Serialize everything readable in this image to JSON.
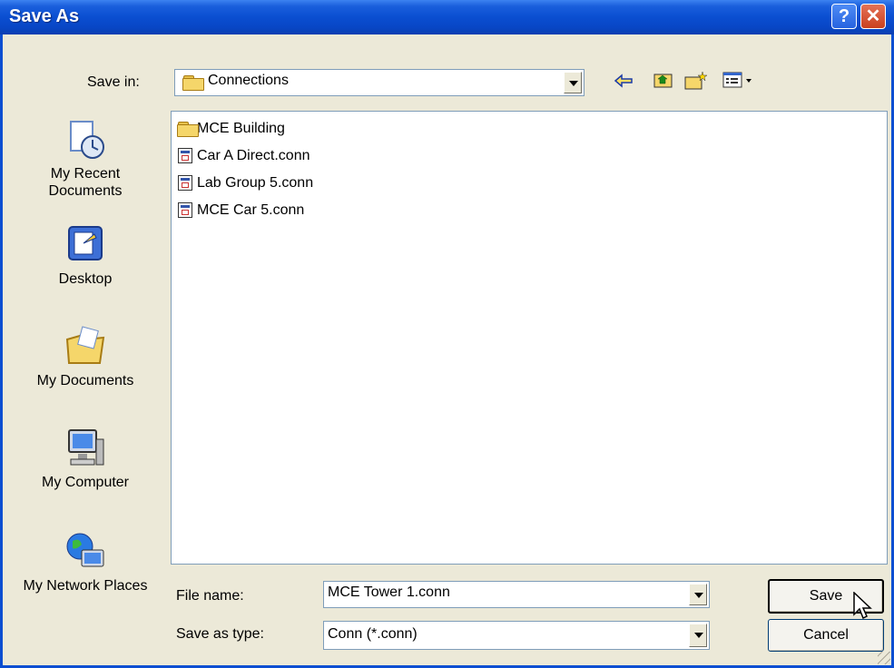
{
  "window": {
    "title": "Save As",
    "help_glyph": "?",
    "close_glyph": "✕"
  },
  "toolbar": {
    "save_in_label": "Save in:",
    "save_in_value": "Connections",
    "back_icon": "back-arrow-icon",
    "up_icon": "up-folder-icon",
    "new_folder_icon": "new-folder-icon",
    "views_icon": "views-menu-icon"
  },
  "places": [
    {
      "label": "My Recent Documents",
      "icon": "recent-documents-icon"
    },
    {
      "label": "Desktop",
      "icon": "desktop-icon"
    },
    {
      "label": "My Documents",
      "icon": "my-documents-icon"
    },
    {
      "label": "My Computer",
      "icon": "my-computer-icon"
    },
    {
      "label": "My Network Places",
      "icon": "network-places-icon"
    }
  ],
  "files": [
    {
      "name": "MCE Building",
      "type": "folder"
    },
    {
      "name": "Car A Direct.conn",
      "type": "conn"
    },
    {
      "name": "Lab Group 5.conn",
      "type": "conn"
    },
    {
      "name": "MCE Car 5.conn",
      "type": "conn"
    }
  ],
  "form": {
    "file_name_label": "File name:",
    "file_name_value": "MCE Tower 1.conn",
    "save_as_type_label": "Save as type:",
    "save_as_type_value": "Conn (*.conn)"
  },
  "buttons": {
    "save": "Save",
    "cancel": "Cancel"
  },
  "colors": {
    "titlebar": "#0a4ed1",
    "dialog_bg": "#ece9d8",
    "close": "#c9401f"
  }
}
